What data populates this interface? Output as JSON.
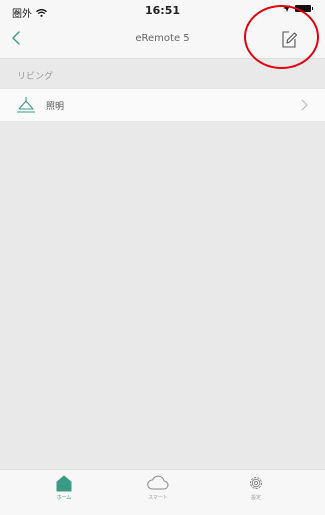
{
  "status_bar": {
    "carrier": "圏外",
    "time": "16:51"
  },
  "nav": {
    "title": "eRemote 5"
  },
  "section": {
    "title": "リビング"
  },
  "rows": [
    {
      "label": "照明",
      "icon": "lamp-icon"
    }
  ],
  "tabs": [
    {
      "label": "ホーム",
      "icon": "home-icon",
      "active": true
    },
    {
      "label": "スマート",
      "icon": "cloud-icon",
      "active": false
    },
    {
      "label": "設定",
      "icon": "gear-icon",
      "active": false
    }
  ],
  "colors": {
    "accent": "#3a9a86",
    "highlight": "#e3000e",
    "background": "#e9e9ea"
  }
}
